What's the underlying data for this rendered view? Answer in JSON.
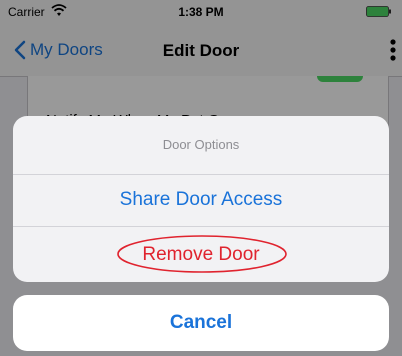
{
  "status_bar": {
    "carrier": "Carrier",
    "time": "1:38 PM",
    "battery_color": "#4cd964",
    "icons": [
      "wifi-icon",
      "battery-icon"
    ]
  },
  "nav_bar": {
    "back_label": "My Doors",
    "title": "Edit Door",
    "back_icon": "chevron-left-icon",
    "menu_icon": "more-vertical-icon"
  },
  "background": {
    "notify_label": "Notify Me When My Pet Goes"
  },
  "action_sheet": {
    "title": "Door Options",
    "share_label": "Share Door Access",
    "remove_label": "Remove Door",
    "cancel_label": "Cancel"
  },
  "colors": {
    "accent": "#1a73d9",
    "destructive": "#e0232e",
    "annotation": "#e0232e"
  }
}
